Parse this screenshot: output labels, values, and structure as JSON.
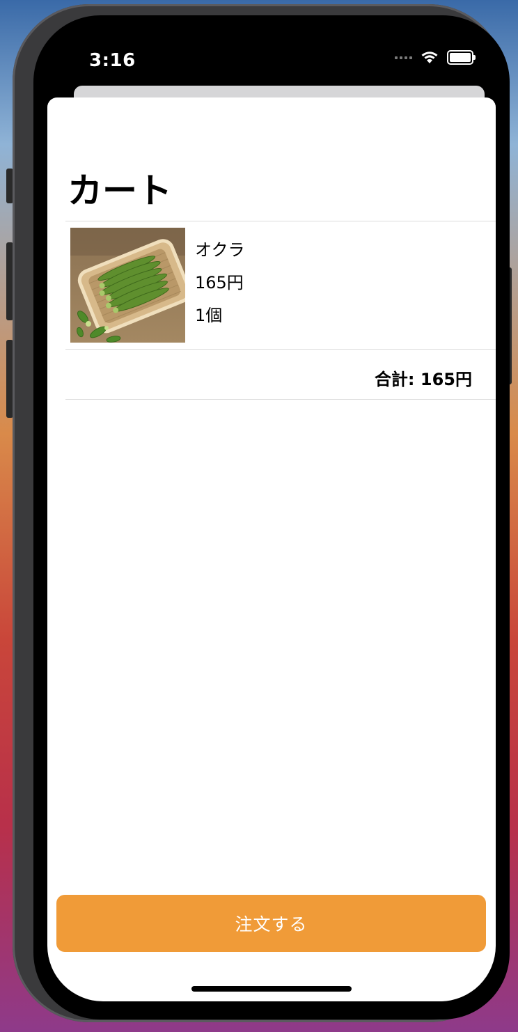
{
  "status_bar": {
    "time": "3:16"
  },
  "cart": {
    "title": "カート",
    "items": [
      {
        "name": "オクラ",
        "price": "165円",
        "quantity": "1個"
      }
    ],
    "total": "合計: 165円"
  },
  "actions": {
    "order_label": "注文する"
  },
  "colors": {
    "accent": "#f09b38"
  }
}
